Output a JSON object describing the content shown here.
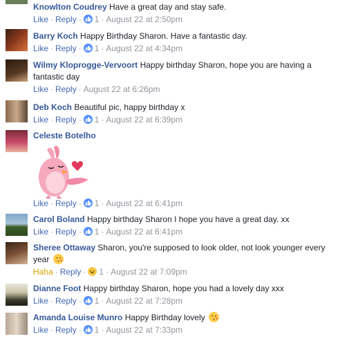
{
  "comments": [
    {
      "name": "Knowlton Coudrey",
      "text": "Have a great day and stay safe.",
      "like": "Like",
      "reply": "Reply",
      "reaction_count": "1",
      "time": "August 22 at 2:50pm"
    },
    {
      "name": "Barry Koch",
      "text": "Happy Birthday Sharon. Have a fantastic day.",
      "like": "Like",
      "reply": "Reply",
      "reaction_count": "1",
      "time": "August 22 at 4:34pm"
    },
    {
      "name": "Wilmy Kloprogge-Vervoort",
      "text": "Happy birthday Sharon, hope you are having a fantastic day",
      "like": "Like",
      "reply": "Reply",
      "time": "August 22 at 6:26pm"
    },
    {
      "name": "Deb Koch",
      "text": "Beautiful pic, happy birthday x",
      "like": "Like",
      "reply": "Reply",
      "reaction_count": "1",
      "time": "August 22 at 6:39pm"
    },
    {
      "name": "Celeste Botelho",
      "like": "Like",
      "reply": "Reply",
      "reaction_count": "1",
      "time": "August 22 at 6:41pm"
    },
    {
      "name": "Carol Boland",
      "text": "Happy birthday Sharon I hope you have a great day. xx",
      "like": "Like",
      "reply": "Reply",
      "reaction_count": "1",
      "time": "August 22 at 6:41pm"
    },
    {
      "name": "Sheree Ottaway",
      "text": "Sharon, you're supposed to look older, not look younger every year",
      "like": "Haha",
      "reply": "Reply",
      "reaction_count": "1",
      "time": "August 22 at 7:09pm"
    },
    {
      "name": "Dianne Foot",
      "text": "Happy birthday Sharon, hope you had a lovely day xxx",
      "like": "Like",
      "reply": "Reply",
      "reaction_count": "1",
      "time": "August 22 at 7:28pm"
    },
    {
      "name": "Amanda Louise Munro",
      "text": "Happy Birthday lovely",
      "like": "Like",
      "reply": "Reply",
      "reaction_count": "1",
      "time": "August 22 at 7:33pm"
    }
  ],
  "colors": {
    "name_link": "#365899",
    "action_link": "#4267b2",
    "timestamp": "#90949c",
    "like_badge": "#5890ff",
    "haha_label": "#d8a200"
  }
}
